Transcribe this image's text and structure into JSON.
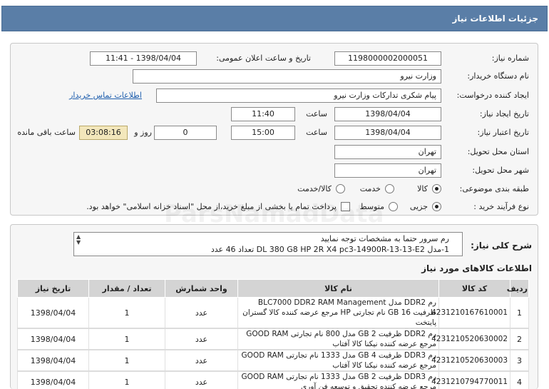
{
  "header": {
    "title": "جزئیات اطلاعات نیاز"
  },
  "form": {
    "need_number_label": "شماره نیاز:",
    "need_number": "1198000002000051",
    "announce_label": "تاریخ و ساعت اعلان عمومی:",
    "announce_value": "1398/04/04 - 11:41",
    "buyer_org_label": "نام دستگاه خریدار:",
    "buyer_org": "وزارت نیرو",
    "creator_label": "ایجاد کننده درخواست:",
    "creator": "پیام شکری تدارکات وزارت نیرو",
    "contact_link": "اطلاعات تماس خریدار",
    "created_date_label": "تاریخ ایجاد نیاز:",
    "created_date": "1398/04/04",
    "time_label": "ساعت",
    "created_time": "11:40",
    "validity_label": "تاریخ اعتبار نیاز:",
    "validity_date": "1398/04/04",
    "validity_time": "15:00",
    "days_value": "0",
    "days_label": "روز و",
    "remaining_time": "03:08:16",
    "remaining_label": "ساعت باقی مانده",
    "province_label": "استان محل تحویل:",
    "province": "تهران",
    "city_label": "شهر محل تحویل:",
    "city": "تهران",
    "category_label": "طبقه بندی موضوعی:",
    "category_options": [
      "کالا",
      "خدمت",
      "کالا/خدمت"
    ],
    "category_selected": 0,
    "process_label": "نوع فرآیند خرید :",
    "process_options": [
      "جزیی",
      "متوسط"
    ],
    "process_selected": 0,
    "payment_note": "پرداخت تمام یا بخشی از مبلغ خرید،از محل \"اسناد خزانه اسلامی\" خواهد بود."
  },
  "summary": {
    "label": "شرح کلی نیاز:",
    "line1": "رم سرور حتما به مشخصات توجه نمایید",
    "line2": "1-مدل DL 380 G8 HP 2R X4 pc3-14900R-13-13-E2 تعداد 46 عدد"
  },
  "items": {
    "section_title": "اطلاعات کالاهای مورد نیاز",
    "columns": [
      "ردیف",
      "کد کالا",
      "نام کالا",
      "واحد شمارش",
      "تعداد / مقدار",
      "تاریخ نیاز"
    ],
    "rows": [
      {
        "row": "1",
        "code": "4231210167610001",
        "name": "رم DDR2 مدل BLC7000 DDR2 RAM Management ظرفیت 16 GB نام تجارتی HP مرجع عرضه کننده کالا گستران پایتخت",
        "unit": "عدد",
        "qty": "1",
        "date": "1398/04/04"
      },
      {
        "row": "2",
        "code": "4231210520630002",
        "name": "رم DDR2 ظرفیت 2 GB مدل 800 نام تجارتی GOOD RAM مرجع عرضه کننده نیکنا کالا آفتاب",
        "unit": "عدد",
        "qty": "1",
        "date": "1398/04/04"
      },
      {
        "row": "3",
        "code": "4231210520630003",
        "name": "رم DDR3 ظرفیت 4 GB مدل 1333 نام تجارتی GOOD RAM مرجع عرضه کننده نیکنا کالا آفتاب",
        "unit": "عدد",
        "qty": "1",
        "date": "1398/04/04"
      },
      {
        "row": "4",
        "code": "4231210794770011",
        "name": "رم DDR3 ظرفیت 2 GB مدل 1333 نام تجارتی GOOD RAM مرجع عرضه کننده تحقیق و توسعه فن آوری",
        "unit": "عدد",
        "qty": "1",
        "date": "1398/04/04"
      }
    ]
  },
  "watermark": "ParsNamadData"
}
